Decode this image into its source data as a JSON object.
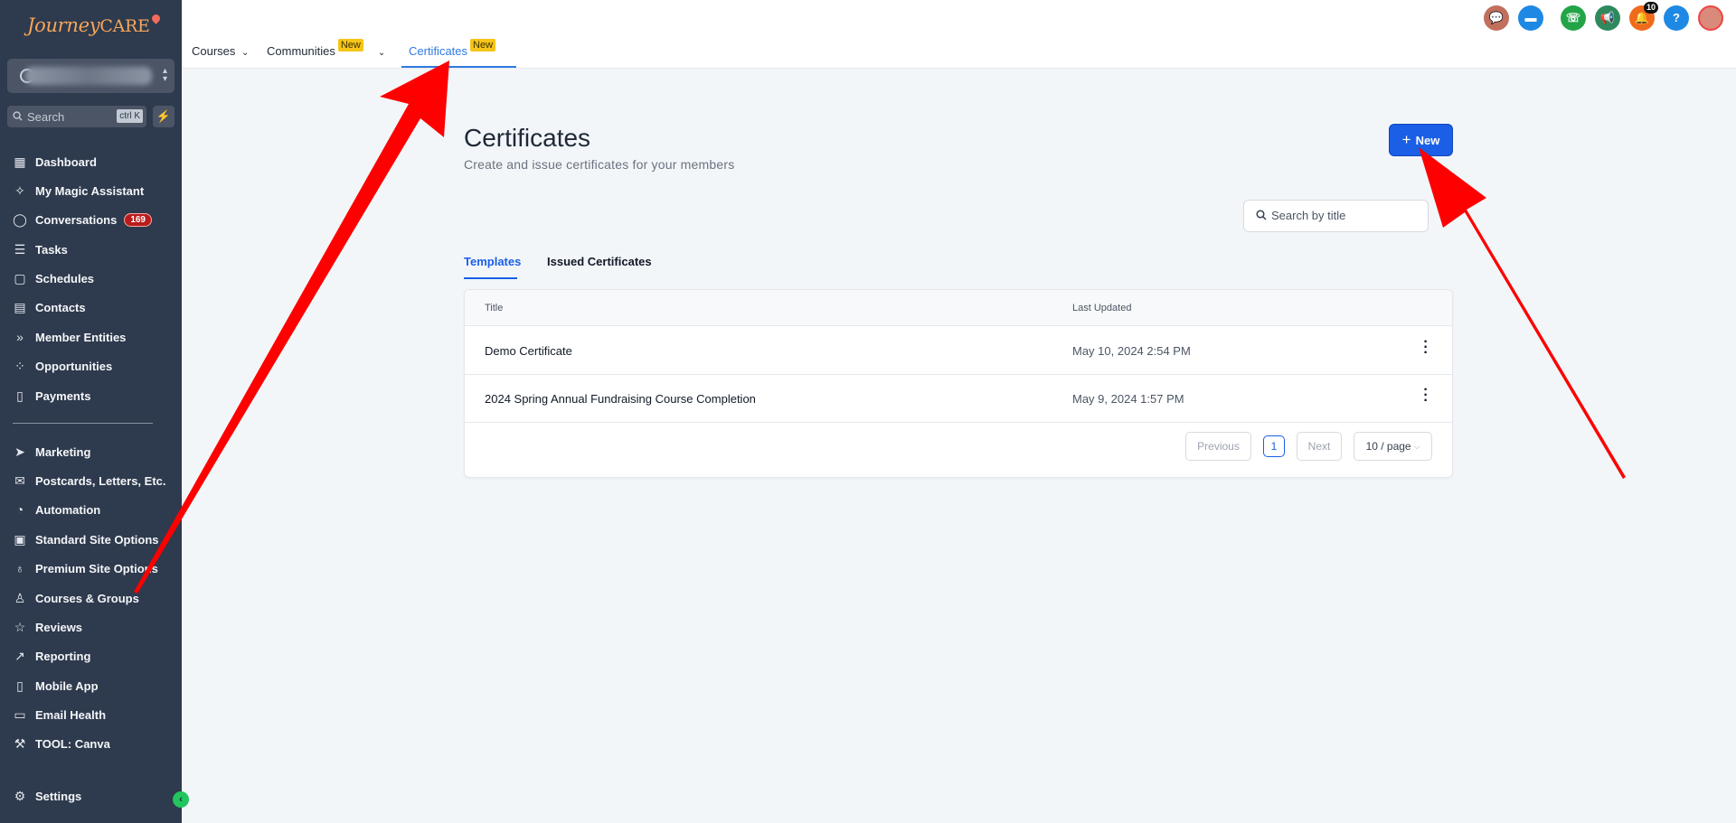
{
  "sidebar": {
    "logo_main": "Journey",
    "logo_accent": "CARE",
    "search_label": "Search",
    "search_shortcut": "ctrl K",
    "items": [
      {
        "label": "Dashboard",
        "icon": "dashboard-icon"
      },
      {
        "label": "My Magic Assistant",
        "icon": "magic-wand-icon"
      },
      {
        "label": "Conversations",
        "icon": "chat-icon",
        "badge": "169"
      },
      {
        "label": "Tasks",
        "icon": "tasks-icon"
      },
      {
        "label": "Schedules",
        "icon": "calendar-icon"
      },
      {
        "label": "Contacts",
        "icon": "contacts-icon"
      },
      {
        "label": "Member Entities",
        "icon": "double-chevron-icon"
      },
      {
        "label": "Opportunities",
        "icon": "opportunities-icon"
      },
      {
        "label": "Payments",
        "icon": "receipt-icon"
      },
      {
        "label": "Marketing",
        "icon": "send-icon"
      },
      {
        "label": "Postcards, Letters, Etc.",
        "icon": "mailbox-icon"
      },
      {
        "label": "Automation",
        "icon": "automation-icon"
      },
      {
        "label": "Standard Site Options",
        "icon": "site-icon"
      },
      {
        "label": "Premium Site Options",
        "icon": "premium-icon"
      },
      {
        "label": "Courses & Groups",
        "icon": "award-icon"
      },
      {
        "label": "Reviews",
        "icon": "star-icon"
      },
      {
        "label": "Reporting",
        "icon": "trend-icon"
      },
      {
        "label": "Mobile App",
        "icon": "mobile-icon"
      },
      {
        "label": "Email Health",
        "icon": "monitor-icon"
      },
      {
        "label": "TOOL: Canva",
        "icon": "wrench-icon"
      },
      {
        "label": "Settings",
        "icon": "gear-icon"
      }
    ]
  },
  "topnav": {
    "tabs": [
      {
        "label": "Courses"
      },
      {
        "label": "Communities",
        "badge": "New"
      },
      {
        "label": "Certificates",
        "badge": "New"
      }
    ],
    "notification_count": "10"
  },
  "main": {
    "title": "Certificates",
    "subtitle": "Create and issue certificates for your members",
    "new_button": "New",
    "search_placeholder": "Search by title",
    "tabs": [
      "Templates",
      "Issued Certificates"
    ],
    "table": {
      "headers": [
        "Title",
        "Last Updated"
      ],
      "rows": [
        {
          "title": "Demo Certificate",
          "updated": "May 10, 2024 2:54 PM"
        },
        {
          "title": "2024 Spring Annual Fundraising Course Completion",
          "updated": "May 9, 2024 1:57 PM"
        }
      ]
    },
    "pagination": {
      "previous": "Previous",
      "current": "1",
      "next": "Next",
      "page_size": "10 / page"
    }
  },
  "colors": {
    "sidebar_bg": "#2e3a4d",
    "accent": "#1a5fe6",
    "annotation_arrow": "#ff0000"
  }
}
